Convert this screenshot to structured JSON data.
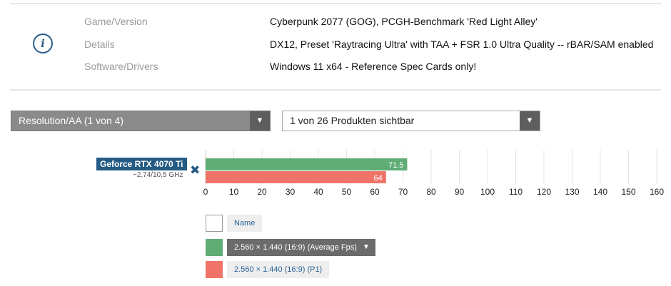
{
  "info": {
    "icon": "info-icon",
    "rows": [
      {
        "label": "Game/Version",
        "value": "Cyberpunk 2077 (GOG), PCGH-Benchmark 'Red Light Alley'"
      },
      {
        "label": "Details",
        "value": "DX12, Preset 'Raytracing Ultra' with TAA + FSR 1.0 Ultra Quality -- rBAR/SAM enabled"
      },
      {
        "label": "Software/Drivers",
        "value": "Windows 11 x64 - Reference Spec Cards only!"
      }
    ]
  },
  "controls": {
    "resolution_select": "Resolution/AA (1 von 4)",
    "products_select": "1 von 26 Produkten sichtbar"
  },
  "product": {
    "name": "Geforce RTX 4070 Ti",
    "clock": "~2,74/10,5 GHz",
    "remove_symbol": "✖"
  },
  "legend": {
    "name_label": "Name",
    "avg_label": "2.560 × 1.440 (16:9) (Average Fps)",
    "avg_arrow": "▼",
    "p1_label": "2.560 × 1.440 (16:9) (P1)"
  },
  "chart_data": {
    "type": "bar",
    "orientation": "horizontal",
    "categories": [
      "Geforce RTX 4070 Ti"
    ],
    "series": [
      {
        "name": "2.560 × 1.440 (16:9) (Average Fps)",
        "values": [
          71.5
        ],
        "color": "#5fad75"
      },
      {
        "name": "2.560 × 1.440 (16:9) (P1)",
        "values": [
          64
        ],
        "color": "#f0736a"
      }
    ],
    "xlim": [
      0,
      160
    ],
    "xticks": [
      0,
      10,
      20,
      30,
      40,
      50,
      60,
      70,
      80,
      90,
      100,
      110,
      120,
      130,
      140,
      150,
      160
    ],
    "grid": true
  }
}
